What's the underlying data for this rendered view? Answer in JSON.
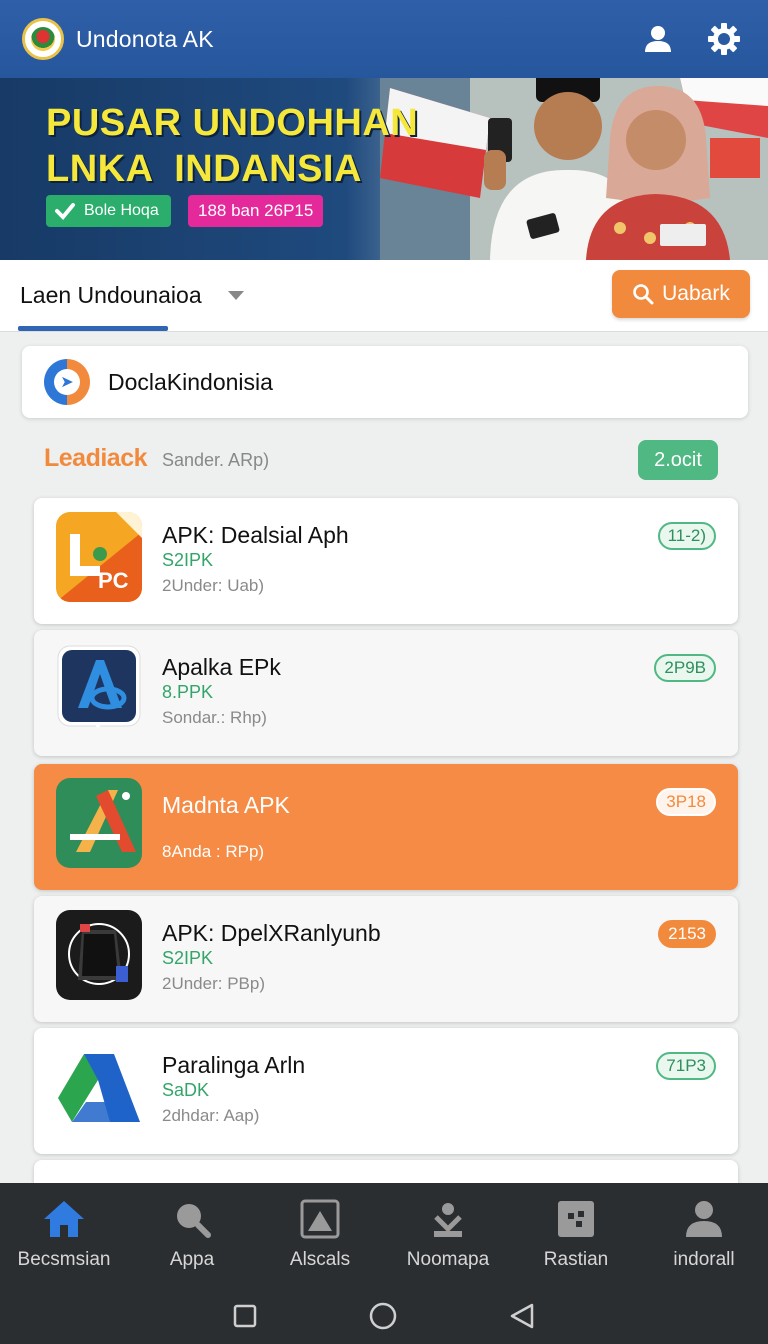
{
  "header": {
    "app_title": "Undonota AK"
  },
  "banner": {
    "headline_line1": "PUSAR UNDOHHAN",
    "headline_line2": "LNKA  INDANSIA",
    "chip_green": "Bole Hoqa",
    "chip_pink": "188 ban 26P15"
  },
  "tabs": {
    "current": "Laen Undounaioa",
    "search_button": "Uabark"
  },
  "searchbox": {
    "text": "DoclaKindonisia"
  },
  "section": {
    "title": "Leadiack",
    "subtitle": "Sander. ARp)",
    "badge": "2.ocit"
  },
  "cards": [
    {
      "name": "APK: Dealsial Aph",
      "type": "S2IPK",
      "sub": "2Under: Uab)",
      "badge": "11-2)"
    },
    {
      "name": "Apalka EPk",
      "type": "8.PPK",
      "sub": "Sondar.: Rhp)",
      "badge": "2P9B"
    },
    {
      "name": "Madnta APK",
      "type": "",
      "sub": "8Anda : RPp)",
      "badge": "3P18"
    },
    {
      "name": "APK: DpelXRanlyunb",
      "type": "S2IPK",
      "sub": "2Under: PBp)",
      "badge": "2153"
    },
    {
      "name": "Paralinga Arln",
      "type": "SaDK",
      "sub": "2dhdar: Aap)",
      "badge": "71P3"
    }
  ],
  "bottom_nav": [
    {
      "label": "Becsmsian",
      "icon": "home-icon"
    },
    {
      "label": "Appa",
      "icon": "search-icon"
    },
    {
      "label": "Alscals",
      "icon": "image-icon"
    },
    {
      "label": "Noomapa",
      "icon": "download-icon"
    },
    {
      "label": "Rastian",
      "icon": "grid-icon"
    },
    {
      "label": "indorall",
      "icon": "profile-icon"
    }
  ],
  "colors": {
    "primary": "#2f5fa8",
    "accent": "#f28a3d",
    "success": "#4fb883"
  }
}
